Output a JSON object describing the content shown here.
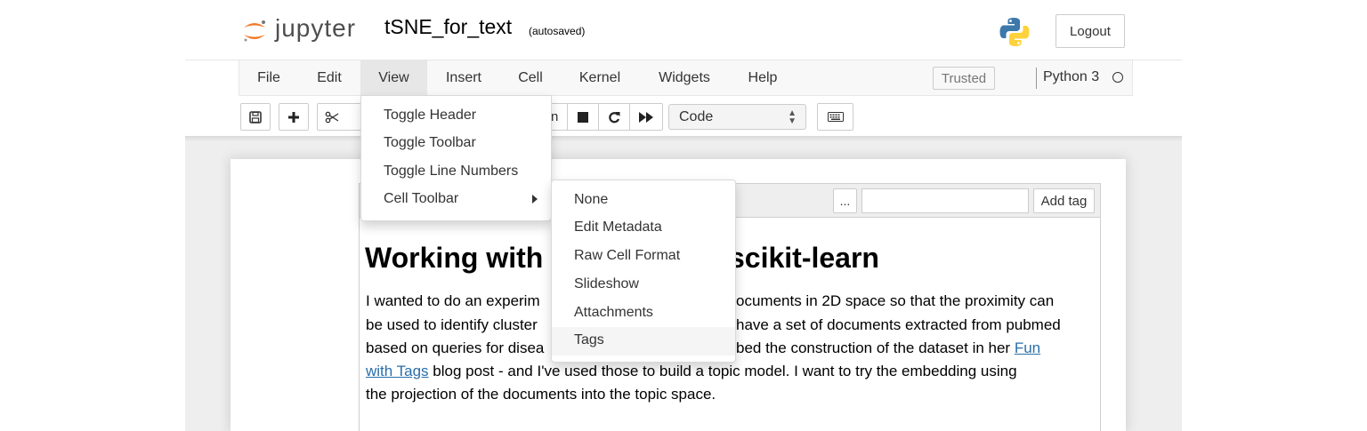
{
  "header": {
    "brand": "jupyter",
    "notebook_title": "tSNE_for_text",
    "autosave_status": "(autosaved)",
    "logout_label": "Logout",
    "kernel_logo_icon": "python-logo-icon"
  },
  "menubar": {
    "items": [
      "File",
      "Edit",
      "View",
      "Insert",
      "Cell",
      "Kernel",
      "Widgets",
      "Help"
    ],
    "active": "View",
    "trusted_label": "Trusted",
    "kernel_name": "Python 3"
  },
  "toolbar": {
    "icons": [
      "save-icon",
      "plus-icon",
      "scissors-icon",
      "stop-icon",
      "restart-icon",
      "fast-forward-icon",
      "keyboard-icon"
    ],
    "partial_glyph": "n",
    "cell_type": "Code"
  },
  "view_menu": {
    "items": [
      "Toggle Header",
      "Toggle Toolbar",
      "Toggle Line Numbers",
      "Cell Toolbar"
    ]
  },
  "cell_toolbar_submenu": {
    "items": [
      "None",
      "Edit Metadata",
      "Raw Cell Format",
      "Slideshow",
      "Attachments",
      "Tags"
    ],
    "highlighted": "Tags"
  },
  "cell": {
    "tag_more_label": "...",
    "tag_input_value": "",
    "add_tag_label": "Add tag",
    "heading_left": "Working with",
    "heading_right": "scikit-learn",
    "lines": [
      {
        "a": "I wanted to do an experim",
        "b": "ocuments in 2D space so that the proximity can"
      },
      {
        "a": "be used to identify cluster",
        "b": "have a set of documents extracted from pubmed"
      },
      {
        "a": "based on queries for disea",
        "b": "bed the construction of the dataset in her ",
        "link": "Fun"
      },
      {
        "link": "with Tags",
        "b": " blog post - and I've used those to build a topic model. I want to try the embedding using"
      },
      {
        "b": "the projection of the documents into the topic space."
      }
    ]
  }
}
